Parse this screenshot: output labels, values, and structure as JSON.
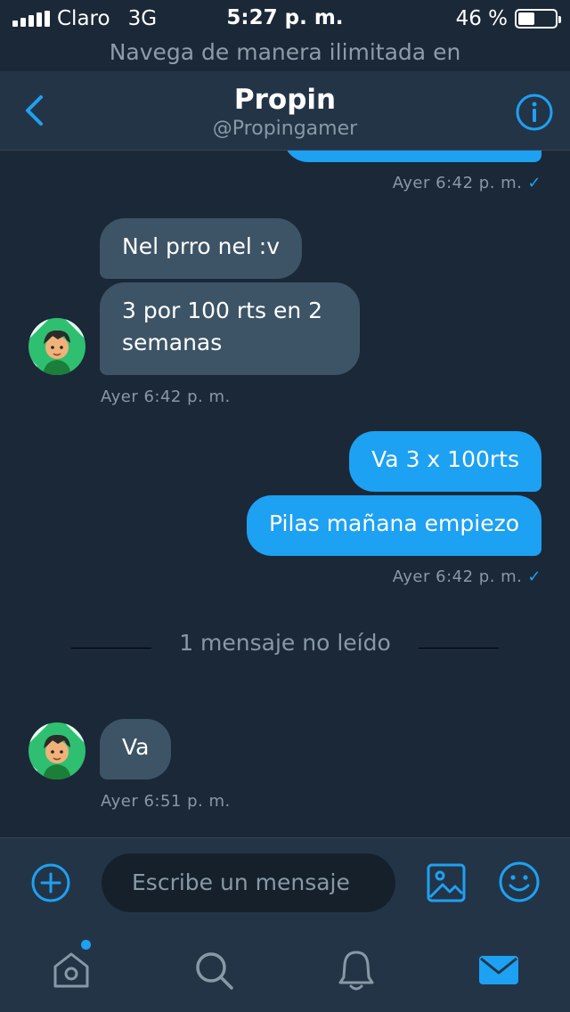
{
  "status_bar": {
    "carrier": "Claro",
    "network": "3G",
    "time": "5:27 p. m.",
    "battery": "46 %",
    "battery_level": 0.46
  },
  "promo_banner": "Navega de manera ilimitada en",
  "header": {
    "name": "Propin",
    "handle": "@Propingamer"
  },
  "messages": [
    {
      "type": "sent",
      "meta": "Ayer 6:42 p. m.",
      "read": "✓"
    },
    {
      "type": "received",
      "texts": [
        "Nel prro nel :v",
        "3 por 100 rts en 2 semanas"
      ],
      "meta": "Ayer 6:42 p. m."
    },
    {
      "type": "sent",
      "texts": [
        "Va 3 x 100rts",
        "Pilas mañana empiezo"
      ],
      "meta": "Ayer 6:42 p. m.",
      "read": "✓"
    },
    {
      "type": "received",
      "texts": [
        "Va"
      ],
      "meta": "Ayer 6:51 p. m."
    }
  ],
  "unread_divider": "1 mensaje no leído",
  "compose": {
    "placeholder": "Escribe un mensaje"
  },
  "tabs": [
    "home-icon",
    "search-icon",
    "notifications-icon",
    "messages-icon"
  ],
  "colors": {
    "accent": "#1da1f2",
    "background": "#1b2838",
    "received_bubble": "#3d5466",
    "bar": "#243447"
  }
}
